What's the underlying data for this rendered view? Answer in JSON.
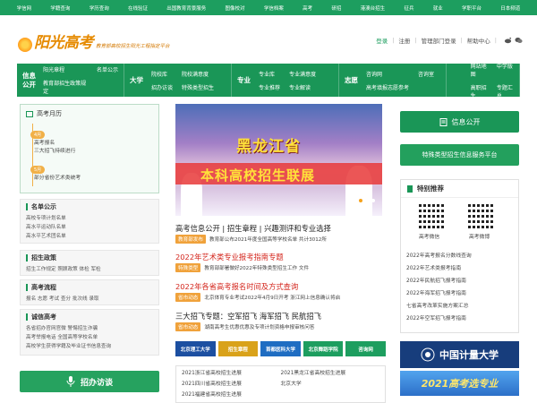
{
  "topnav": [
    "学信网",
    "学籍查询",
    "学历查询",
    "在线验证",
    "出国教育背景服务",
    "图像校对",
    "学信档案",
    "高考",
    "研招",
    "港澳台招生",
    "征兵",
    "就业",
    "学职平台",
    "日本频道"
  ],
  "logo": {
    "main": "阳光高考",
    "sub": "教育部高校招生阳光工程指定平台"
  },
  "header_links": {
    "login": "登录",
    "register": "注册",
    "admin": "管理部门登录",
    "help": "帮助中心"
  },
  "nav": [
    {
      "head": "信息公开",
      "links": [
        "阳光章程",
        "名单公示",
        "教育部招生政策规定",
        ""
      ]
    },
    {
      "head": "大学",
      "links": [
        "院校库",
        "院校满意度",
        "招办访谈",
        "特殊类型招生"
      ]
    },
    {
      "head": "专业",
      "links": [
        "专业库",
        "专业满意度",
        "专业推荐",
        "专业解读"
      ]
    },
    {
      "head": "志愿",
      "links": [
        "咨询网",
        "咨询室",
        "高考填报志愿参考",
        ""
      ]
    },
    {
      "head": "",
      "links": [
        "网站地图",
        "中学版",
        "高职招生",
        "专题汇总"
      ]
    }
  ],
  "calendar": {
    "title": "高考月历",
    "tag1": "4月",
    "items1": [
      "高考报名",
      "三大招飞持续进行"
    ],
    "tag2": "5月",
    "items2": [
      "部分省份艺术类统考"
    ]
  },
  "left_sections": [
    {
      "title": "名单公示",
      "rows": [
        "高校专项计划名单",
        "高水平运动队名单",
        "高水平艺术团名单"
      ]
    },
    {
      "title": "招生政策",
      "rows": [
        "招生工作规定 照顾政策 体检 军检"
      ]
    },
    {
      "title": "高考流程",
      "rows": [
        "报名 志愿 考试 查分 批次线 录取"
      ]
    },
    {
      "title": "诚信高考",
      "rows": [
        "各省招办官网官微 警惕招生诈骗",
        "高考举报电话 全国高等学校名单",
        "高校学生获得学籍及毕业证书信息查询"
      ]
    }
  ],
  "interview_button": "招办访谈",
  "banner": {
    "line1": "黑龙江省",
    "line2": "本科高校招生联展"
  },
  "news": [
    {
      "title": "高考信息公开 | 招生章程 | 兴趣测评和专业选择",
      "red": false,
      "badge": "教育部发布",
      "detail": "教育部公布2021年度全国高等学校名单 共计3012所"
    },
    {
      "title": "2022年艺术类专业报考指南专题",
      "red": true,
      "badge": "特殊类型",
      "detail": "教育部部署做好2022年特殊类型招生工作   文件"
    },
    {
      "title": "2022年各省高考报名时间及方式查询",
      "red": true,
      "badge": "省市动态",
      "detail": "北京体育专业考试2022年4月9日开考  浙江网上信息确认将启"
    },
    {
      "title": "三大招飞专题：空军招飞 海军招飞 民航招飞",
      "red": false,
      "badge": "省市动态",
      "detail": "湖南高考生优惠优惠及专项计划资格申报审核问答"
    }
  ],
  "logos": [
    {
      "label": "北京理工大学",
      "color": "#1c4fa1"
    },
    {
      "label": "招生章程",
      "color": "#d9a21a"
    },
    {
      "label": "首都医科大学",
      "color": "#1f6dc2"
    },
    {
      "label": "北京舞蹈学院",
      "color": "#1d9e5f"
    },
    {
      "label": "咨询网",
      "color": "#1d9e5f"
    }
  ],
  "more_news": [
    [
      "2021浙江省高校招生进展",
      "2021黑龙江省高校招生进展"
    ],
    [
      "2021四川省高校招生进展",
      "北京大学"
    ],
    [
      "2021福建省高校招生进展",
      ""
    ]
  ],
  "right": {
    "info_btn": "信息公开",
    "special_btn": "特殊类型招生信息服务平台",
    "featured": "特别推荐",
    "wechat": "高考微信",
    "weibo": "高考微博",
    "links": [
      "2022年高考报名分数线查询",
      "2022年艺术类报考指南",
      "2022年民航招飞报考指南",
      "2022年海军招飞报考指南",
      "七省高考改革实施方案汇总",
      "2022年空军招飞报考指南"
    ],
    "ad1": "中国计量大学",
    "ad2": "2021高考选专业"
  }
}
